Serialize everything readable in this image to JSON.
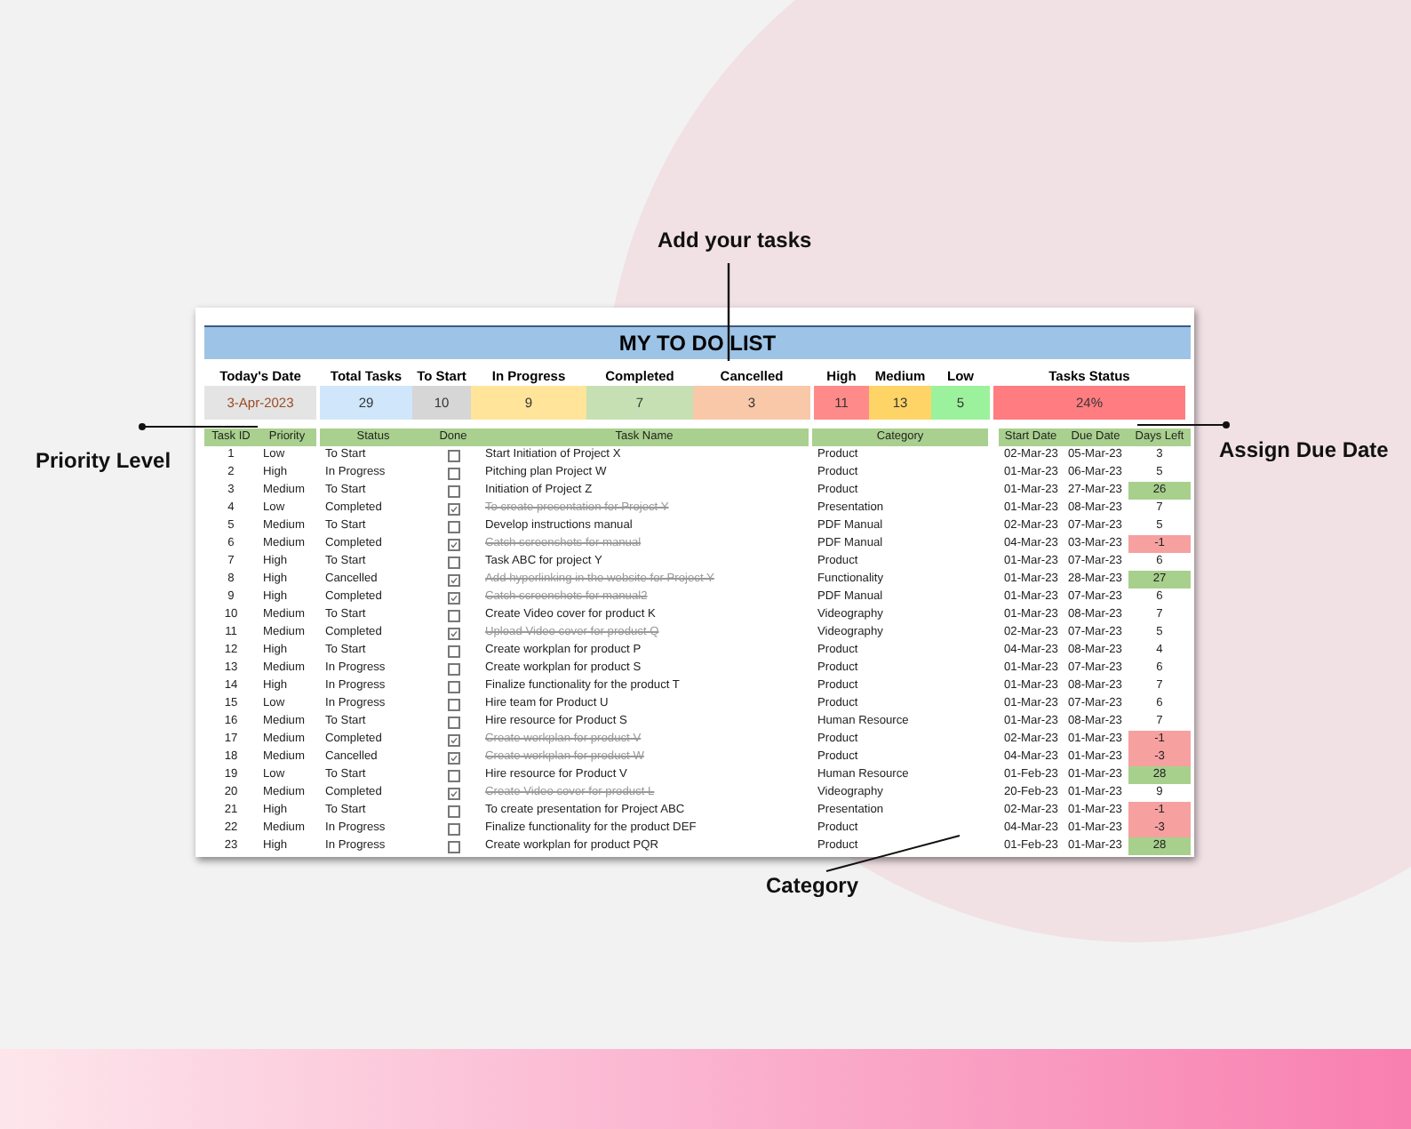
{
  "title": "MY TO DO LIST",
  "summary": [
    {
      "items": [
        {
          "label": "Today's Date",
          "value": "3-Apr-2023",
          "color": "#e4e4e4"
        }
      ]
    },
    {
      "items": [
        {
          "label": "Total Tasks",
          "value": "29",
          "color": "#cfe6fb"
        },
        {
          "label": "To Start",
          "value": "10",
          "color": "#d6d6d6"
        },
        {
          "label": "In Progress",
          "value": "9",
          "color": "#ffe49a"
        },
        {
          "label": "Completed",
          "value": "7",
          "color": "#c6e0b4"
        },
        {
          "label": "Cancelled",
          "value": "3",
          "color": "#f8c8a8"
        }
      ]
    },
    {
      "items": [
        {
          "label": "High",
          "value": "11",
          "color": "#ff8a8a"
        },
        {
          "label": "Medium",
          "value": "13",
          "color": "#ffd466"
        },
        {
          "label": "Low",
          "value": "5",
          "color": "#9cf29c"
        }
      ]
    },
    {
      "items": [
        {
          "label": "Tasks Status",
          "value": "24%",
          "color": "#ff7c80"
        }
      ]
    }
  ],
  "columns": [
    "Task ID",
    "Priority",
    "Status",
    "Done",
    "Task Name",
    "Category",
    "Start Date",
    "Due Date",
    "Days Left"
  ],
  "rows": [
    {
      "id": "1",
      "priority": "Low",
      "status": "To Start",
      "done": false,
      "task": "Start Initiation of Project X",
      "category": "Product",
      "start": "02-Mar-23",
      "due": "05-Mar-23",
      "days": "3"
    },
    {
      "id": "2",
      "priority": "High",
      "status": "In Progress",
      "done": false,
      "task": "Pitching plan Project W",
      "category": "Product",
      "start": "01-Mar-23",
      "due": "06-Mar-23",
      "days": "5"
    },
    {
      "id": "3",
      "priority": "Medium",
      "status": "To Start",
      "done": false,
      "task": "Initiation of Project Z",
      "category": "Product",
      "start": "01-Mar-23",
      "due": "27-Mar-23",
      "days": "26",
      "color": "#a8d08d"
    },
    {
      "id": "4",
      "priority": "Low",
      "status": "Completed",
      "done": true,
      "task": "To create presentation for Project Y",
      "category": "Presentation",
      "start": "01-Mar-23",
      "due": "08-Mar-23",
      "days": "7"
    },
    {
      "id": "5",
      "priority": "Medium",
      "status": "To Start",
      "done": false,
      "task": "Develop instructions manual",
      "category": "PDF Manual",
      "start": "02-Mar-23",
      "due": "07-Mar-23",
      "days": "5"
    },
    {
      "id": "6",
      "priority": "Medium",
      "status": "Completed",
      "done": true,
      "task": "Catch screenshots for manual",
      "category": "PDF Manual",
      "start": "04-Mar-23",
      "due": "03-Mar-23",
      "days": "-1",
      "color": "#f6a0a0"
    },
    {
      "id": "7",
      "priority": "High",
      "status": "To Start",
      "done": false,
      "task": "Task ABC for project Y",
      "category": "Product",
      "start": "01-Mar-23",
      "due": "07-Mar-23",
      "days": "6"
    },
    {
      "id": "8",
      "priority": "High",
      "status": "Cancelled",
      "done": true,
      "task": "Add hyperlinking in the website for Project Y",
      "category": "Functionality",
      "start": "01-Mar-23",
      "due": "28-Mar-23",
      "days": "27",
      "color": "#a8d08d"
    },
    {
      "id": "9",
      "priority": "High",
      "status": "Completed",
      "done": true,
      "task": "Catch screenshots for manual2",
      "category": "PDF Manual",
      "start": "01-Mar-23",
      "due": "07-Mar-23",
      "days": "6"
    },
    {
      "id": "10",
      "priority": "Medium",
      "status": "To Start",
      "done": false,
      "task": "Create Video cover for product K",
      "category": "Videography",
      "start": "01-Mar-23",
      "due": "08-Mar-23",
      "days": "7"
    },
    {
      "id": "11",
      "priority": "Medium",
      "status": "Completed",
      "done": true,
      "task": "Upload Video cover for product Q",
      "category": "Videography",
      "start": "02-Mar-23",
      "due": "07-Mar-23",
      "days": "5"
    },
    {
      "id": "12",
      "priority": "High",
      "status": "To Start",
      "done": false,
      "task": "Create workplan for product P",
      "category": "Product",
      "start": "04-Mar-23",
      "due": "08-Mar-23",
      "days": "4"
    },
    {
      "id": "13",
      "priority": "Medium",
      "status": "In Progress",
      "done": false,
      "task": "Create workplan for product S",
      "category": "Product",
      "start": "01-Mar-23",
      "due": "07-Mar-23",
      "days": "6"
    },
    {
      "id": "14",
      "priority": "High",
      "status": "In Progress",
      "done": false,
      "task": "Finalize functionality for the product T",
      "category": "Product",
      "start": "01-Mar-23",
      "due": "08-Mar-23",
      "days": "7"
    },
    {
      "id": "15",
      "priority": "Low",
      "status": "In Progress",
      "done": false,
      "task": "Hire team for Product U",
      "category": "Product",
      "start": "01-Mar-23",
      "due": "07-Mar-23",
      "days": "6"
    },
    {
      "id": "16",
      "priority": "Medium",
      "status": "To Start",
      "done": false,
      "task": "Hire resource for Product S",
      "category": "Human Resource",
      "start": "01-Mar-23",
      "due": "08-Mar-23",
      "days": "7"
    },
    {
      "id": "17",
      "priority": "Medium",
      "status": "Completed",
      "done": true,
      "task": "Create workplan for product V",
      "category": "Product",
      "start": "02-Mar-23",
      "due": "01-Mar-23",
      "days": "-1",
      "color": "#f6a0a0"
    },
    {
      "id": "18",
      "priority": "Medium",
      "status": "Cancelled",
      "done": true,
      "task": "Create workplan for product W",
      "category": "Product",
      "start": "04-Mar-23",
      "due": "01-Mar-23",
      "days": "-3",
      "color": "#f6a0a0"
    },
    {
      "id": "19",
      "priority": "Low",
      "status": "To Start",
      "done": false,
      "task": "Hire resource for Product V",
      "category": "Human Resource",
      "start": "01-Feb-23",
      "due": "01-Mar-23",
      "days": "28",
      "color": "#a8d08d"
    },
    {
      "id": "20",
      "priority": "Medium",
      "status": "Completed",
      "done": true,
      "task": "Create Video cover for product L",
      "category": "Videography",
      "start": "20-Feb-23",
      "due": "01-Mar-23",
      "days": "9"
    },
    {
      "id": "21",
      "priority": "High",
      "status": "To Start",
      "done": false,
      "task": "To create presentation for Project ABC",
      "category": "Presentation",
      "start": "02-Mar-23",
      "due": "01-Mar-23",
      "days": "-1",
      "color": "#f6a0a0"
    },
    {
      "id": "22",
      "priority": "Medium",
      "status": "In Progress",
      "done": false,
      "task": "Finalize functionality for the product DEF",
      "category": "Product",
      "start": "04-Mar-23",
      "due": "01-Mar-23",
      "days": "-3",
      "color": "#f6a0a0"
    },
    {
      "id": "23",
      "priority": "High",
      "status": "In Progress",
      "done": false,
      "task": "Create workplan for product PQR",
      "category": "Product",
      "start": "01-Feb-23",
      "due": "01-Mar-23",
      "days": "28",
      "color": "#a8d08d"
    }
  ],
  "callouts": [
    {
      "text": "Add your tasks"
    },
    {
      "text": "Priority Level"
    },
    {
      "text": "Assign Due Date"
    },
    {
      "text": "Category"
    }
  ]
}
